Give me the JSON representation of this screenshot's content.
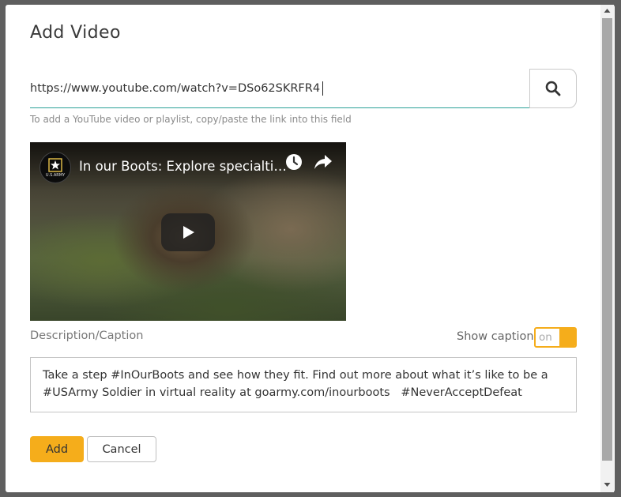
{
  "dialog": {
    "title": "Add Video",
    "url_value": "https://www.youtube.com/watch?v=DSo62SKRFR4",
    "hint": "To add a YouTube video or playlist, copy/paste the link into this field",
    "search_icon": "search-icon"
  },
  "video": {
    "title": "In our Boots: Explore specialti…",
    "channel_logo_text": "U.S.ARMY",
    "icons": [
      "clock-icon",
      "share-icon",
      "play-icon"
    ]
  },
  "caption": {
    "description_label": "Description/Caption",
    "show_caption_label": "Show caption",
    "toggle_label": "on",
    "toggle_on": true,
    "text": "Take a step #InOurBoots and see how they fit. Find out more about what it’s like to be a #USArmy Soldier in virtual reality at goarmy.com/inourboots   #NeverAcceptDefeat"
  },
  "actions": {
    "add_label": "Add",
    "cancel_label": "Cancel"
  },
  "colors": {
    "accent": "#f5ad1b",
    "input_underline": "#2aa198",
    "overlay": "#5f5f5f"
  }
}
